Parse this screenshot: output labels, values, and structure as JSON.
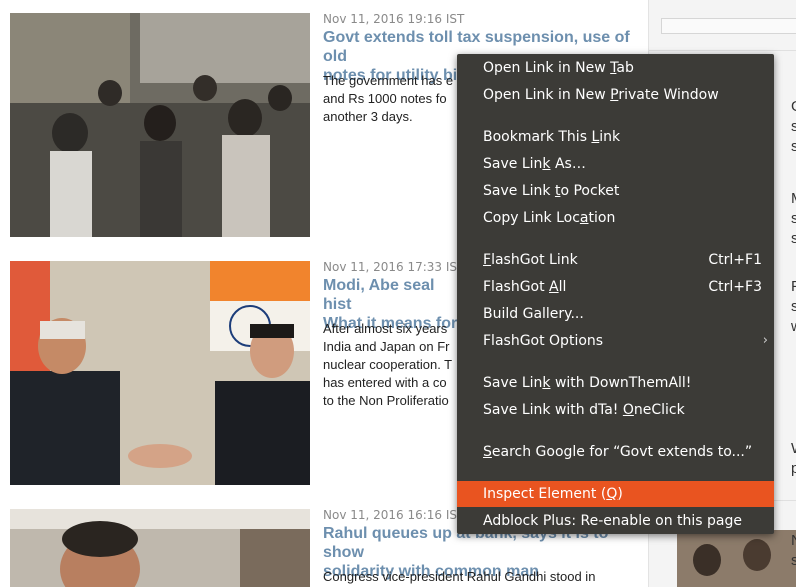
{
  "articles": [
    {
      "timestamp": "Nov 11, 2016 19:16 IST",
      "headline_line1": "Govt extends toll tax suspension, use of old",
      "headline_line2": "notes for utility bills till Nov 14",
      "summary_lines": [
        "The government has e",
        "and Rs 1000 notes fo",
        "another 3 days."
      ]
    },
    {
      "timestamp": "Nov 11, 2016 17:33 IST",
      "headline_line1": "Modi, Abe seal hist",
      "headline_line2": "What it means for",
      "summary_lines": [
        "After almost six years",
        "India and Japan on Fr",
        "nuclear cooperation. T",
        "has entered with a co",
        "to the Non Proliferatio"
      ]
    },
    {
      "timestamp": "Nov 11, 2016 16:16 IST",
      "headline_line1": "Rahul queues up at bank, says it is to show",
      "headline_line2": "solidarity with common man",
      "summary_lines": [
        "Congress vice-president Rahul Gandhi stood in"
      ]
    }
  ],
  "right_column_letters": [
    "G",
    "s",
    "s",
    "M",
    "s",
    "s",
    "P",
    "s",
    "w",
    "W",
    "p",
    "N",
    "s"
  ],
  "context_menu": {
    "items": [
      {
        "pre": "Open Link in New ",
        "u": "T",
        "post": "ab",
        "shortcut": ""
      },
      {
        "pre": "Open Link in New ",
        "u": "P",
        "post": "rivate Window",
        "shortcut": ""
      },
      {
        "pre": "Bookmark This ",
        "u": "L",
        "post": "ink",
        "shortcut": ""
      },
      {
        "pre": "Save Lin",
        "u": "k",
        "post": " As…",
        "shortcut": ""
      },
      {
        "pre": "Save Link ",
        "u": "t",
        "post": "o Pocket",
        "shortcut": ""
      },
      {
        "pre": "Copy Link Loc",
        "u": "a",
        "post": "tion",
        "shortcut": ""
      },
      {
        "pre": "",
        "u": "F",
        "post": "lashGot Link",
        "shortcut": "Ctrl+F1"
      },
      {
        "pre": "FlashGot ",
        "u": "A",
        "post": "ll",
        "shortcut": "Ctrl+F3"
      },
      {
        "pre": "Build Gallery...",
        "u": "",
        "post": "",
        "shortcut": ""
      },
      {
        "pre": "FlashGot Options",
        "u": "",
        "post": "",
        "shortcut": ""
      },
      {
        "pre": "Save Lin",
        "u": "k",
        "post": " with DownThemAll!",
        "shortcut": ""
      },
      {
        "pre": "Save Link with dTa! ",
        "u": "O",
        "post": "neClick",
        "shortcut": ""
      },
      {
        "pre": "",
        "u": "S",
        "post": "earch Google for “Govt extends to...”",
        "shortcut": ""
      },
      {
        "pre": "Inspect Element (",
        "u": "Q",
        "post": ")",
        "shortcut": ""
      },
      {
        "pre": "Adblock Plus: Re-enable on this page",
        "u": "",
        "post": "",
        "shortcut": ""
      }
    ],
    "submenu_arrow": "›"
  },
  "colors": {
    "menu_bg": "#3c3b37",
    "highlight": "#e95420",
    "headline": "#6d8fae"
  }
}
